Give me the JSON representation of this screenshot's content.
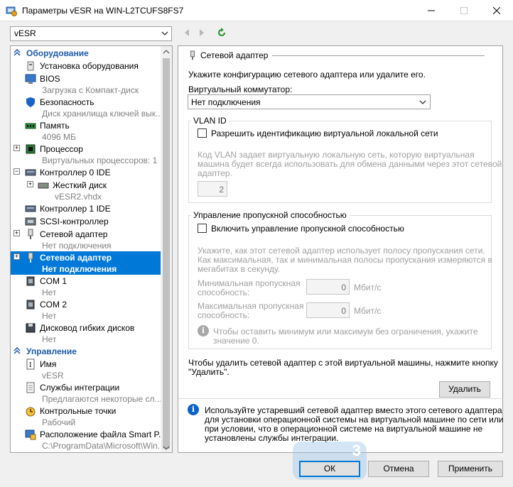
{
  "window": {
    "title": "Параметры vESR на WIN-L2TCUFS8FS7"
  },
  "toolbar": {
    "vm_select": "vESR"
  },
  "tree": {
    "hardware_header": "Оборудование",
    "management_header": "Управление",
    "items": [
      {
        "main": "Установка оборудования",
        "sub": ""
      },
      {
        "main": "BIOS",
        "sub": "Загрузка с Компакт-диск"
      },
      {
        "main": "Безопасность",
        "sub": "Диск хранилища ключей вык..."
      },
      {
        "main": "Память",
        "sub": "4096 МБ"
      },
      {
        "main": "Процессор",
        "sub": "Виртуальных процессоров: 1"
      },
      {
        "main": "Контроллер 0 IDE",
        "sub": ""
      },
      {
        "main": "Жесткий диск",
        "sub": "vESR2.vhdx"
      },
      {
        "main": "Контроллер 1 IDE",
        "sub": ""
      },
      {
        "main": "SCSI-контроллер",
        "sub": ""
      },
      {
        "main": "Сетевой адаптер",
        "sub": "Нет подключения"
      },
      {
        "main": "Сетевой адаптер",
        "sub": "Нет подключения"
      },
      {
        "main": "COM 1",
        "sub": "Нет"
      },
      {
        "main": "COM 2",
        "sub": "Нет"
      },
      {
        "main": "Дисковод гибких дисков",
        "sub": "Нет"
      },
      {
        "main": "Имя",
        "sub": "vESR"
      },
      {
        "main": "Службы интеграции",
        "sub": "Предлагаются некоторые сл..."
      },
      {
        "main": "Контрольные точки",
        "sub": "Рабочий"
      },
      {
        "main": "Расположение файла Smart P...",
        "sub": "C:\\ProgramData\\Microsoft\\Win..."
      }
    ]
  },
  "panel": {
    "header": "Сетевой адаптер",
    "intro": "Укажите конфигурацию сетевого адаптера или удалите его.",
    "switch_label": "Виртуальный коммутатор:",
    "switch_value": "Нет подключения",
    "vlan": {
      "title": "VLAN ID",
      "checkbox_label": "Разрешить идентификацию виртуальной локальной сети",
      "desc_1": "Код VLAN задает виртуальную локальную сеть, которую виртуальная",
      "desc_2": "машина будет всегда использовать для обмена данными через этот сетевой",
      "desc_3": "адаптер.",
      "value": "2"
    },
    "bandwidth": {
      "title": "Управление пропускной способностью",
      "checkbox_label": "Включить управление пропускной способностью",
      "desc_1": "Укажите, как этот сетевой адаптер использует полосу пропускания сети.",
      "desc_2": "Как максимальная, так и минимальная полосы пропускания измеряются в",
      "desc_3": "мегабитах в секунду.",
      "min_label_1": "Минимальная пропускная",
      "min_label_2": "способность:",
      "min_value": "0",
      "max_label_1": "Максимальная пропускная",
      "max_label_2": "способность:",
      "max_value": "0",
      "unit": "Мбит/с",
      "hint_1": "Чтобы оставить минимум или максимум без ограничения, укажите",
      "hint_2": "значение 0."
    },
    "remove_text_1": "Чтобы удалить сетевой адаптер с этой виртуальной машины, нажмите кнопку",
    "remove_text_2": "\"Удалить\".",
    "remove_button": "Удалить",
    "info_1": "Используйте устаревший сетевой адаптер вместо этого сетевого адаптера",
    "info_2": "для установки операционной системы на виртуальной машине по сети или",
    "info_3": "при условии, что в операционной системе на виртуальной машине не",
    "info_4": "установлены службы интеграции."
  },
  "buttons": {
    "ok": "ОК",
    "cancel": "Отмена",
    "apply": "Применить"
  },
  "badge": "3",
  "colors": {
    "selection": "#0078d7",
    "section_header": "#1e5aa8",
    "info_icon": "#0a64c8"
  }
}
